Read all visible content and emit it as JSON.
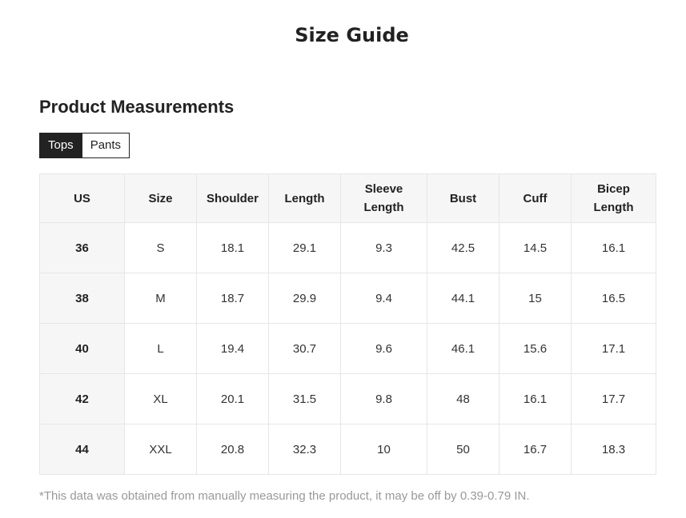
{
  "page": {
    "title": "Size Guide"
  },
  "section": {
    "title": "Product Measurements"
  },
  "tabs": [
    {
      "label": "Tops",
      "active": true
    },
    {
      "label": "Pants",
      "active": false
    }
  ],
  "table": {
    "headers": [
      [
        "US"
      ],
      [
        "Size"
      ],
      [
        "Shoulder"
      ],
      [
        "Length"
      ],
      [
        "Sleeve",
        "Length"
      ],
      [
        "Bust"
      ],
      [
        "Cuff"
      ],
      [
        "Bicep",
        "Length"
      ]
    ],
    "rows": [
      [
        "36",
        "S",
        "18.1",
        "29.1",
        "9.3",
        "42.5",
        "14.5",
        "16.1"
      ],
      [
        "38",
        "M",
        "18.7",
        "29.9",
        "9.4",
        "44.1",
        "15",
        "16.5"
      ],
      [
        "40",
        "L",
        "19.4",
        "30.7",
        "9.6",
        "46.1",
        "15.6",
        "17.1"
      ],
      [
        "42",
        "XL",
        "20.1",
        "31.5",
        "9.8",
        "48",
        "16.1",
        "17.7"
      ],
      [
        "44",
        "XXL",
        "20.8",
        "32.3",
        "10",
        "50",
        "16.7",
        "18.3"
      ]
    ]
  },
  "footnote": "*This data was obtained from manually measuring the product, it may be off by 0.39-0.79 IN.",
  "colors": {
    "tab_active_bg": "#222222",
    "header_bg": "#f6f6f6",
    "border": "#e6e6e6",
    "note": "#999999"
  }
}
